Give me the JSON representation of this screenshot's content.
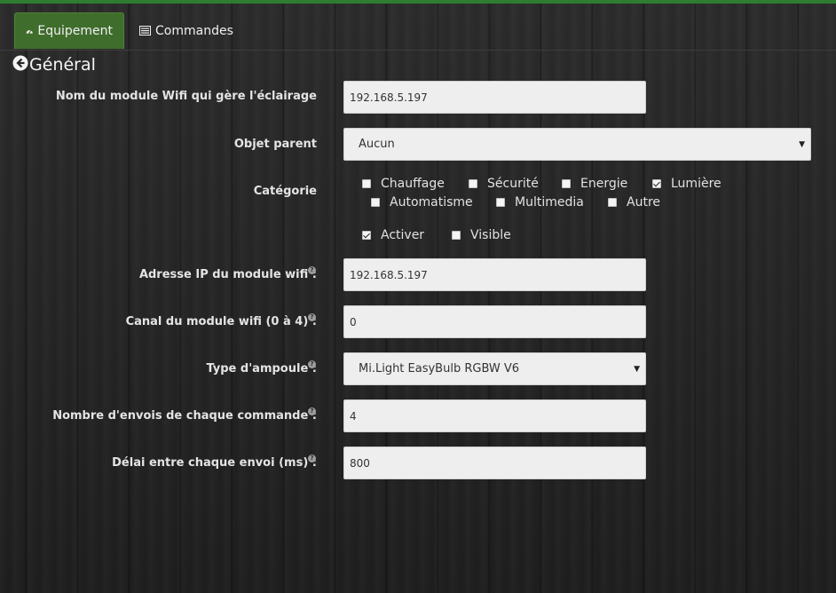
{
  "tabs": {
    "equipement": "Equipement",
    "commandes": "Commandes"
  },
  "section": {
    "title": "Général"
  },
  "form": {
    "module_name": {
      "label": "Nom du module Wifi qui gère l'éclairage",
      "value": "192.168.5.197"
    },
    "parent": {
      "label": "Objet parent",
      "value": "Aucun"
    },
    "category": {
      "label": "Catégorie",
      "options": [
        {
          "label": "Chauffage",
          "checked": false
        },
        {
          "label": "Sécurité",
          "checked": false
        },
        {
          "label": "Energie",
          "checked": false
        },
        {
          "label": "Lumière",
          "checked": true
        },
        {
          "label": "Automatisme",
          "checked": false
        },
        {
          "label": "Multimedia",
          "checked": false
        },
        {
          "label": "Autre",
          "checked": false
        }
      ]
    },
    "activer": {
      "label": "Activer",
      "checked": true
    },
    "visible": {
      "label": "Visible",
      "checked": false
    },
    "ip": {
      "label": "Adresse IP du module wifi :",
      "value": "192.168.5.197",
      "help": "?"
    },
    "canal": {
      "label": "Canal du module wifi (0 à 4) :",
      "value": "0",
      "help": "?"
    },
    "type": {
      "label": "Type d'ampoule :",
      "value": "Mi.Light EasyBulb RGBW V6",
      "help": "?"
    },
    "nombre": {
      "label": "Nombre d'envois de chaque commande :",
      "value": "4",
      "help": "?"
    },
    "delai": {
      "label": "Délai entre chaque envoi (ms) :",
      "value": "800",
      "help": "?"
    }
  },
  "colors": {
    "accent": "#2e7d32",
    "active_tab": "#3f6d2c"
  },
  "icons": {
    "equipement": "dashboard-icon",
    "commandes": "list-icon",
    "back": "circle-arrow-left-icon",
    "help": "question-circle-icon"
  }
}
